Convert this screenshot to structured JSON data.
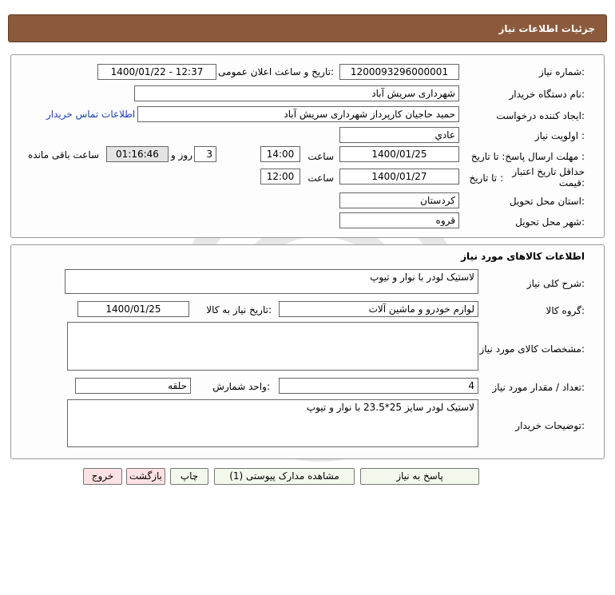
{
  "header": {
    "title": "جزئیات اطلاعات نیاز"
  },
  "form": {
    "need_no_label": "شماره نیاز:",
    "need_no": "1200093296000001",
    "announce_label": "تاریخ و ساعت اعلان عمومی:",
    "announce_value": "1400/01/22 - 12:37",
    "buyer_org_label": "نام دستگاه خریدار:",
    "buyer_org": "شهرداری سریش آباد",
    "creator_label": "ایجاد کننده درخواست:",
    "creator": "حمید حاجیان کارپرداز شهرداری سریش آباد",
    "contact_link": "اطلاعات تماس خریدار",
    "priority_label": "اولویت نیاز :",
    "priority": "عادي",
    "deadline_label": "مهلت ارسال پاسخ: تا تاریخ :",
    "deadline_date": "1400/01/25",
    "time_label": "ساعت",
    "deadline_time": "14:00",
    "days": "3",
    "days_label": "روز و",
    "remaining_time": "01:16:46",
    "remaining_label": "ساعت باقی مانده",
    "validity_label": "حداقل تاریخ اعتبار قیمت:",
    "validity_to_label": "تا تاریخ :",
    "validity_date": "1400/01/27",
    "validity_time_label": "ساعت",
    "validity_time": "12:00",
    "province_label": "استان محل تحویل:",
    "province": "کردستان",
    "city_label": "شهر محل تحویل:",
    "city": "قروه"
  },
  "goods": {
    "section_title": "اطلاعات کالاهای مورد نیاز",
    "summary_label": "شرح کلی نیاز:",
    "summary": "لاستیک لودر با نوار و تیوپ",
    "group_label": "گروه کالا:",
    "group": "لوازم خودرو و ماشین آلات",
    "need_date_label": "تاریخ نیاز به کالا:",
    "need_date": "1400/01/25",
    "specs_label": "مشخصات کالای مورد نیاز:",
    "specs": "",
    "qty_label": "تعداد / مقدار مورد نیاز:",
    "qty": "4",
    "unit_label": "واحد شمارش:",
    "unit": "حلقه",
    "buyer_notes_label": "توضیحات خریدار:",
    "buyer_notes": "لاستیک لودر سایز 25*23.5 با نوار و تیوپ"
  },
  "buttons": {
    "reply": "پاسخ به نیاز",
    "attachments": "مشاهده مدارک پیوستی (1)",
    "print": "چاپ",
    "back": "بازگشت",
    "exit": "خروج"
  }
}
